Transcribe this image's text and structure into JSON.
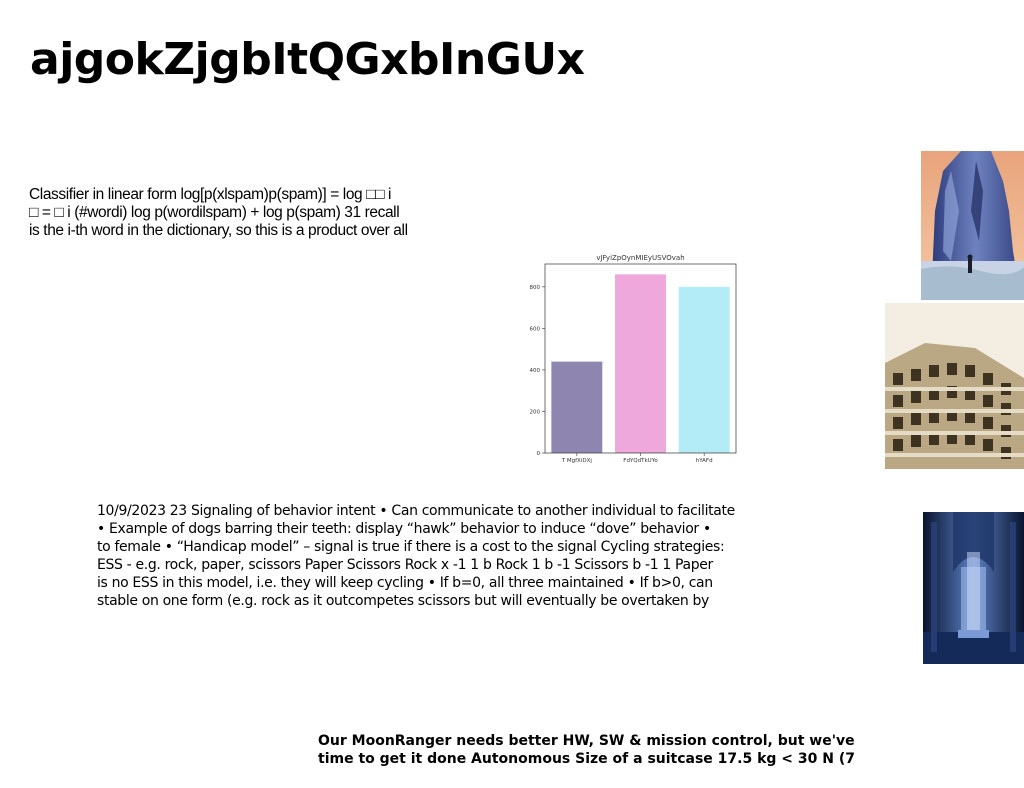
{
  "title": "ajgokZjgbItQGxbInGUx",
  "classifier_text": {
    "lines": [
      "Classifier in linear form log[p(xlspam)p(spam)] = log □□ i",
      "□ = □ i (#wordi) log p(wordilspam) + log p(spam) 31 recall",
      "is the i-th word in the dictionary, so this is a product over all"
    ]
  },
  "signaling_text": {
    "lines": [
      "10/9/2023 23 Signaling of behavior intent • Can communicate to another individual to facilitate",
      "• Example of dogs barring their teeth: display “hawk” behavior to induce “dove” behavior •",
      "to female • “Handicap model” – signal is true if there is a cost to the signal Cycling strategies:",
      "ESS - e.g. rock, paper, scissors Paper Scissors Rock x -1 1 b Rock 1 b -1 Scissors b -1 1 Paper",
      "is no ESS in this model, i.e. they will keep cycling • If b=0, all three maintained • If b>0, can",
      "stable on one form (e.g. rock as it outcompetes scissors but will eventually be overtaken by"
    ]
  },
  "moonranger_text": {
    "lines": [
      "Our MoonRanger needs better HW, SW & mission control, but we've",
      "time to get it done Autonomous Size of a suitcase 17.5 kg < 30 N (7"
    ]
  },
  "chart_data": {
    "type": "bar",
    "title": "vJFyiZpOynMIEyUSVOvah",
    "categories": [
      "T MgfXiDXj",
      "FdYQdTkUYo",
      "hYAFd"
    ],
    "values": [
      440,
      860,
      800
    ],
    "colors": [
      "#8e86b0",
      "#eea8dc",
      "#b3ebf7"
    ],
    "ylim": [
      0,
      910
    ],
    "yticks": [
      0,
      200,
      400,
      600,
      800
    ],
    "xlabel": "",
    "ylabel": "",
    "grid": false
  },
  "images": [
    {
      "name": "cliff-photo",
      "colors": [
        "#f0b38a",
        "#3a4a8c",
        "#c9d6e8"
      ]
    },
    {
      "name": "building-photo",
      "colors": [
        "#f4ede2",
        "#b7a57e",
        "#3d3320"
      ]
    },
    {
      "name": "interior-photo",
      "colors": [
        "#0c1a3a",
        "#5d80c4",
        "#a9c2ef"
      ]
    }
  ]
}
